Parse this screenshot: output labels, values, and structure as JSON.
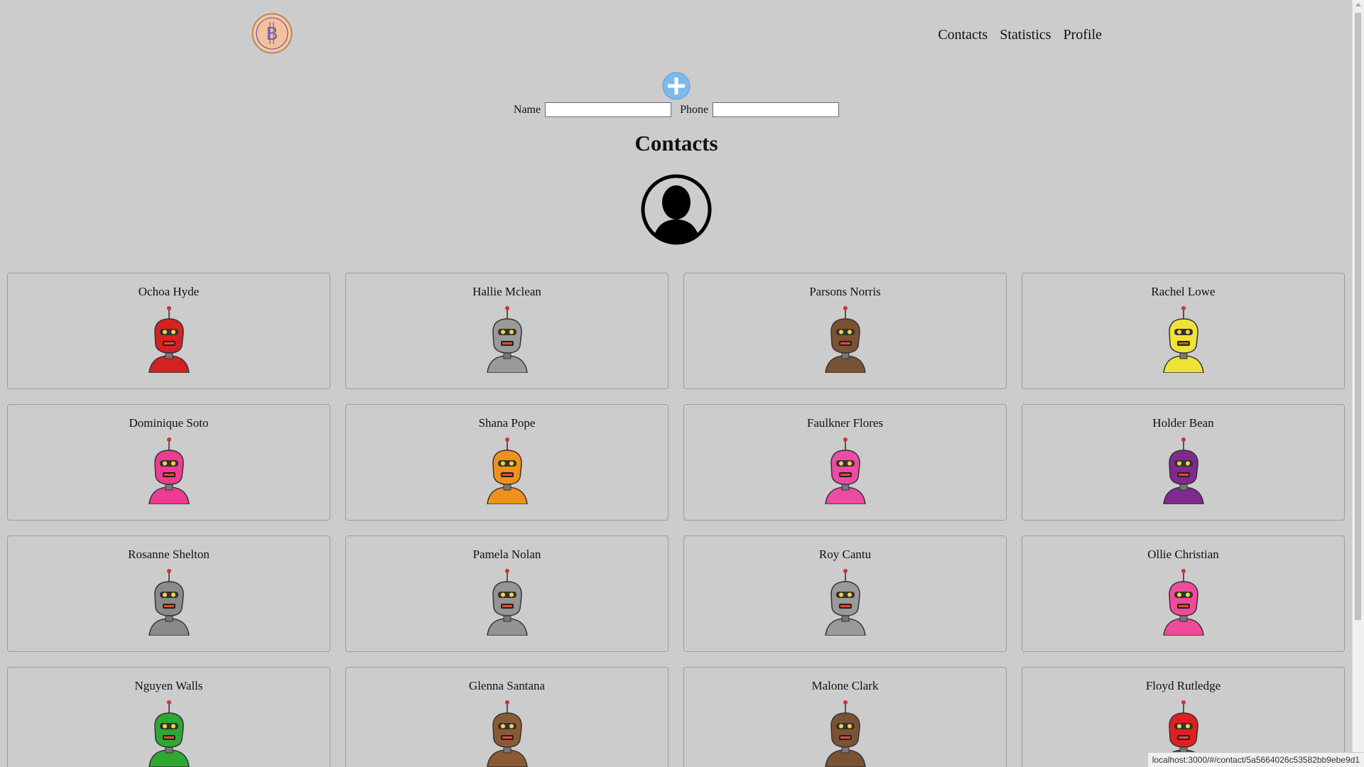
{
  "header": {
    "logo_icon": "bitcoin-logo-icon",
    "nav": [
      {
        "label": "Contacts"
      },
      {
        "label": "Statistics"
      },
      {
        "label": "Profile"
      }
    ]
  },
  "add_form": {
    "add_icon": "plus-circle-icon",
    "name_label": "Name",
    "name_value": "",
    "phone_label": "Phone",
    "phone_value": ""
  },
  "page_title": "Contacts",
  "avatar_icon": "user-silhouette-icon",
  "contacts": [
    {
      "name": "Ochoa Hyde",
      "robot_color": "#d42222"
    },
    {
      "name": "Hallie Mclean",
      "robot_color": "#9a9a9a"
    },
    {
      "name": "Parsons Norris",
      "robot_color": "#7a5234"
    },
    {
      "name": "Rachel Lowe",
      "robot_color": "#efe33a"
    },
    {
      "name": "Dominique Soto",
      "robot_color": "#f03b92"
    },
    {
      "name": "Shana Pope",
      "robot_color": "#f0921a"
    },
    {
      "name": "Faulkner Flores",
      "robot_color": "#ee4ba5"
    },
    {
      "name": "Holder Bean",
      "robot_color": "#7f2a8e"
    },
    {
      "name": "Rosanne Shelton",
      "robot_color": "#8a8a8a"
    },
    {
      "name": "Pamela Nolan",
      "robot_color": "#949494"
    },
    {
      "name": "Roy Cantu",
      "robot_color": "#9a9a9a"
    },
    {
      "name": "Ollie Christian",
      "robot_color": "#f04b9a"
    },
    {
      "name": "Nguyen Walls",
      "robot_color": "#2fa832"
    },
    {
      "name": "Glenna Santana",
      "robot_color": "#8b5a34"
    },
    {
      "name": "Malone Clark",
      "robot_color": "#7a5234"
    },
    {
      "name": "Floyd Rutledge",
      "robot_color": "#e02020"
    }
  ],
  "status_url": "localhost:3000/#/contact/5a5664026c53582bb9ebe9d1"
}
